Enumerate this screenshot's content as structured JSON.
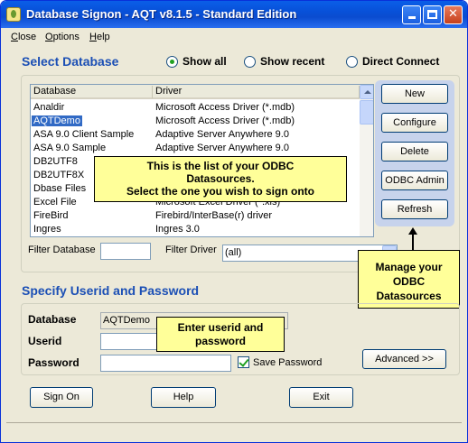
{
  "window": {
    "title": "Database Signon - AQT v8.1.5 - Standard Edition",
    "controls": {
      "minimize": "minimize-icon",
      "maximize": "maximize-icon",
      "close": "✕"
    }
  },
  "menu": [
    {
      "label_pre": "",
      "label_ul": "C",
      "label_post": "lose"
    },
    {
      "label_pre": "",
      "label_ul": "O",
      "label_post": "ptions"
    },
    {
      "label_pre": "",
      "label_ul": "H",
      "label_post": "elp"
    }
  ],
  "select_db": {
    "title": "Select Database",
    "radios": [
      {
        "label": "Show all",
        "checked": true
      },
      {
        "label": "Show recent",
        "checked": false
      },
      {
        "label": "Direct Connect",
        "checked": false
      }
    ],
    "columns": [
      "Database",
      "Driver"
    ],
    "rows": [
      {
        "db": "Analdir",
        "driver": "Microsoft Access Driver (*.mdb)"
      },
      {
        "db": "AQTDemo",
        "driver": "Microsoft Access Driver (*.mdb)",
        "selected": true
      },
      {
        "db": "ASA 9.0 Client Sample",
        "driver": "Adaptive Server Anywhere 9.0"
      },
      {
        "db": "ASA 9.0 Sample",
        "driver": "Adaptive Server Anywhere 9.0"
      },
      {
        "db": "DB2UTF8",
        "driver": ""
      },
      {
        "db": "DB2UTF8X",
        "driver": ""
      },
      {
        "db": "Dbase Files",
        "driver": ""
      },
      {
        "db": "Excel File",
        "driver": "Microsoft Excel Driver (*.xls)"
      },
      {
        "db": "FireBird",
        "driver": "Firebird/InterBase(r) driver"
      },
      {
        "db": "Ingres",
        "driver": "Ingres 3.0"
      }
    ],
    "buttons": [
      "New",
      "Configure",
      "Delete",
      "ODBC Admin",
      "Refresh"
    ],
    "filter_db_label": "Filter Database",
    "filter_db_value": "",
    "filter_driver_label": "Filter Driver",
    "filter_driver_value": "(all)"
  },
  "callouts": {
    "list": [
      "This is the list of your ODBC",
      "Datasources.",
      "Select the one you wish to sign onto"
    ],
    "manage": [
      "Manage your",
      "ODBC",
      "Datasources"
    ],
    "userid": [
      "Enter userid and",
      "password"
    ]
  },
  "userid_section": {
    "title": "Specify Userid and Password",
    "database_label": "Database",
    "database_value": "AQTDemo",
    "userid_label": "Userid",
    "userid_value": "",
    "password_label": "Password",
    "password_value": "",
    "save_password_label": "Save Password",
    "save_password_checked": true,
    "advanced_label": "Advanced >>"
  },
  "footer_buttons": {
    "sign_on": "Sign On",
    "help": "Help",
    "exit": "Exit"
  }
}
